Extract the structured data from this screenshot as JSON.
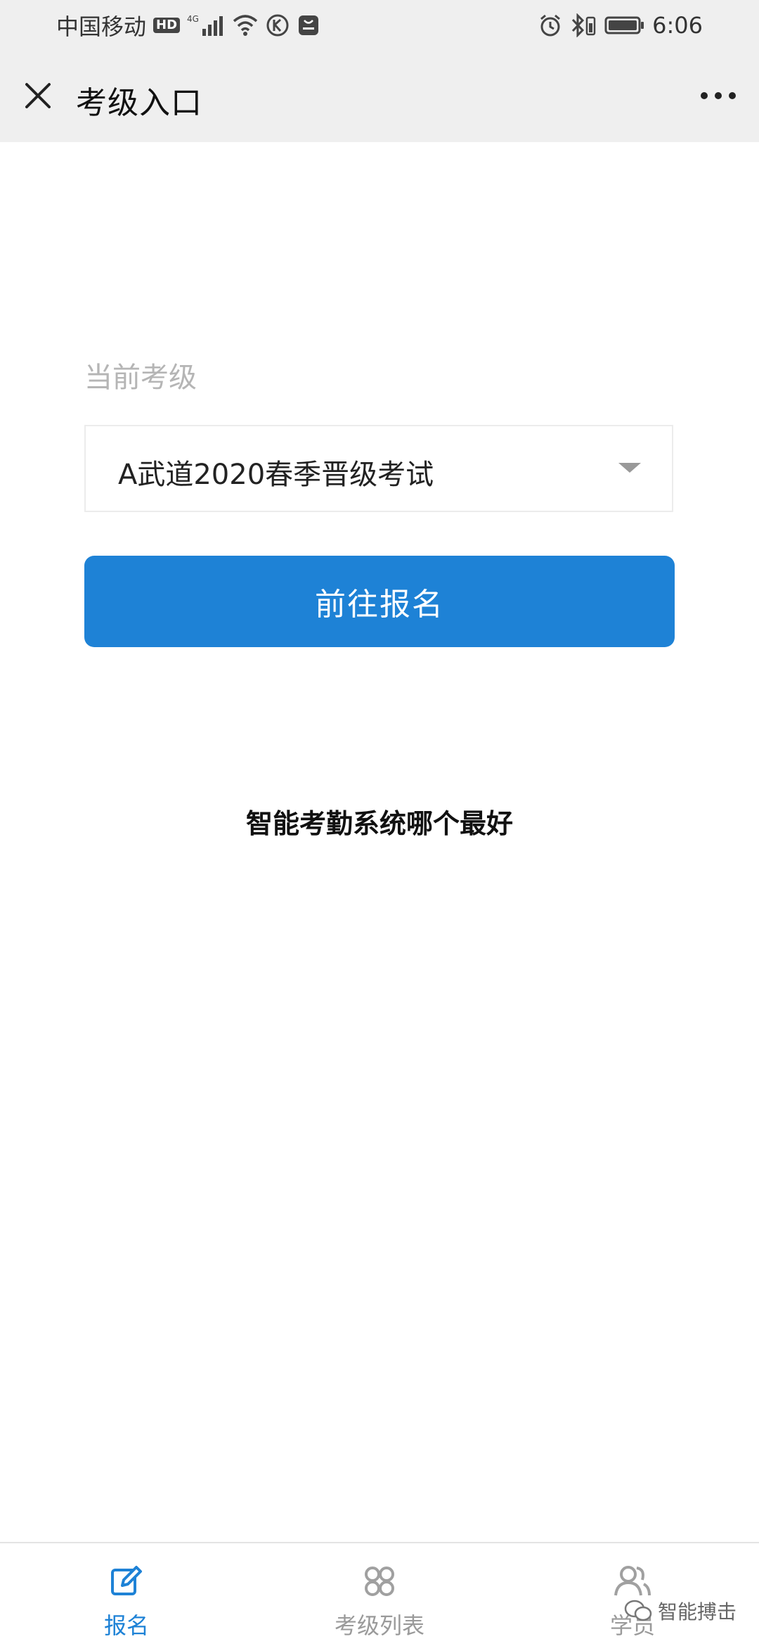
{
  "status_bar": {
    "carrier": "中国移动",
    "hd_badge": "HD",
    "network": "4G",
    "time": "6:06"
  },
  "header": {
    "title": "考级入口"
  },
  "form": {
    "label": "当前考级",
    "selected_exam": "A武道2020春季晋级考试",
    "submit_label": "前往报名"
  },
  "caption": "智能考勤系统哪个最好",
  "tabs": [
    {
      "label": "报名",
      "icon": "edit-icon",
      "active": true
    },
    {
      "label": "考级列表",
      "icon": "grid-icon",
      "active": false
    },
    {
      "label": "学员",
      "icon": "users-icon",
      "active": false
    }
  ],
  "watermark": "智能搏击",
  "colors": {
    "accent": "#1e82d6",
    "header_bg": "#efefef",
    "label_gray": "#b5b5b5"
  }
}
